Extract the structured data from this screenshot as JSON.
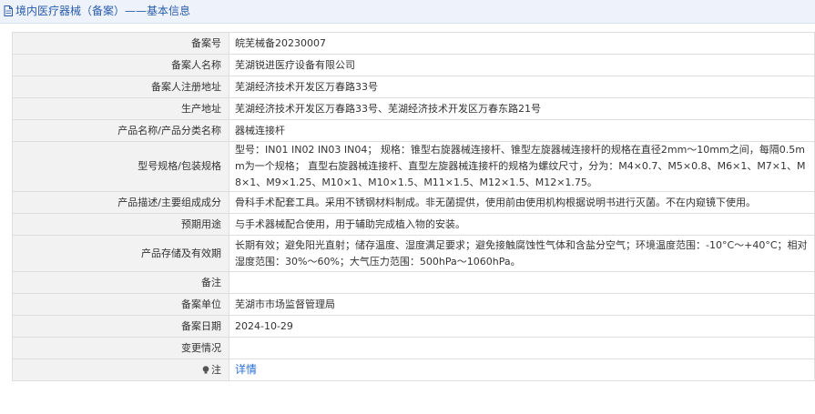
{
  "header": {
    "title": "境内医疗器械（备案）——基本信息"
  },
  "rows": [
    {
      "label": "备案号",
      "value": "皖芜械备20230007"
    },
    {
      "label": "备案人名称",
      "value": "芜湖锐进医疗设备有限公司"
    },
    {
      "label": "备案人注册地址",
      "value": "芜湖经济技术开发区万春路33号"
    },
    {
      "label": "生产地址",
      "value": "芜湖经济技术开发区万春路33号、芜湖经济技术开发区万春东路21号"
    },
    {
      "label": "产品名称/产品分类名称",
      "value": "器械连接杆"
    },
    {
      "label": "型号规格/包装规格",
      "value": "型号：IN01 IN02 IN03 IN04； 规格：锥型右旋器械连接杆、锥型左旋器械连接杆的规格在直径2mm～10mm之间，每隔0.5mm为一个规格； 直型右旋器械连接杆、直型左旋器械连接杆的规格为螺纹尺寸，分为：M4×0.7、M5×0.8、M6×1、M7×1、M8×1、M9×1.25、M10×1、M10×1.5、M11×1.5、M12×1.5、M12×1.75。"
    },
    {
      "label": "产品描述/主要组成成分",
      "value": "骨科手术配套工具。采用不锈钢材料制成。非无菌提供，使用前由使用机构根据说明书进行灭菌。不在内窥镜下使用。"
    },
    {
      "label": "预期用途",
      "value": "与手术器械配合使用，用于辅助完成植入物的安装。"
    },
    {
      "label": "产品存储及有效期",
      "value": "长期有效；避免阳光直射；储存温度、湿度满足要求；避免接触腐蚀性气体和含盐分空气；环境温度范围：-10°C～+40°C；相对湿度范围：30%～60%；大气压力范围：500hPa～1060hPa。"
    },
    {
      "label": "备注",
      "value": ""
    },
    {
      "label": "备案单位",
      "value": "芜湖市市场监督管理局"
    },
    {
      "label": "备案日期",
      "value": "2024-10-29"
    },
    {
      "label": "变更情况",
      "value": ""
    }
  ],
  "note_row": {
    "label": "注",
    "link": "详情"
  },
  "colors": {
    "header_text": "#2a5caa",
    "header_bg": "#eef3fb",
    "label_bg": "#f2f2f2",
    "link": "#2a6fd6"
  }
}
